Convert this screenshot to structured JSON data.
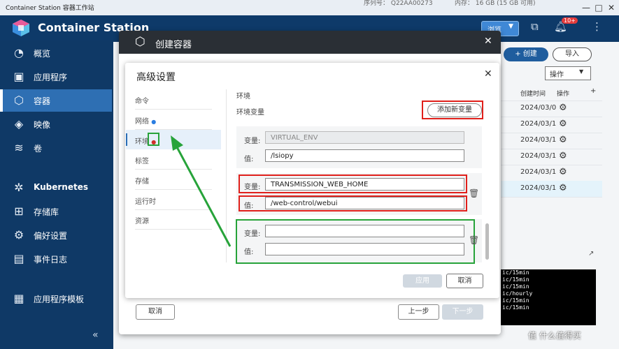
{
  "window": {
    "title": "Container Station 容器工作站",
    "serial_fragment": "序列号： Q22AA00273",
    "memory_fragment": "内存： 16 GB (15 GB 可用)",
    "controls": [
      "minimize-icon",
      "maximize-icon",
      "close-icon"
    ]
  },
  "header": {
    "app_name": "Container Station",
    "browse_label": "浏览",
    "notification_badge": "10+"
  },
  "sidebar": {
    "items": [
      {
        "label": "概览",
        "icon": "overview-icon"
      },
      {
        "label": "应用程序",
        "icon": "applications-icon"
      },
      {
        "label": "容器",
        "icon": "container-icon",
        "active": true
      },
      {
        "label": "映像",
        "icon": "images-icon"
      },
      {
        "label": "卷",
        "icon": "volume-icon"
      },
      {
        "label": "Kubernetes",
        "icon": "kubernetes-icon"
      },
      {
        "label": "存储库",
        "icon": "registry-icon"
      },
      {
        "label": "偏好设置",
        "icon": "gear-icon"
      },
      {
        "label": "事件日志",
        "icon": "log-icon"
      },
      {
        "label": "应用程序模板",
        "icon": "template-icon"
      }
    ]
  },
  "background": {
    "create_label": "+ 创建",
    "import_label": "导入",
    "actions_select": "操作",
    "columns": [
      "创建时间",
      "操作"
    ],
    "dates": [
      "2024/03/0",
      "2024/03/1",
      "2024/03/1",
      "2024/03/1",
      "2024/03/1",
      "2024/03/1"
    ],
    "log_lines": [
      "ic/15min",
      "ic/15min",
      "ic/15min",
      "ic/hourly",
      "ic/15min",
      "ic/15min"
    ]
  },
  "create_dialog": {
    "title": "创建容器",
    "cancel_label": "取消",
    "prev_label": "上一步",
    "next_label": "下一步"
  },
  "advanced": {
    "title": "高级设置",
    "nav": [
      {
        "label": "命令"
      },
      {
        "label": "网络",
        "dot": "blue"
      },
      {
        "label": "环境",
        "dot": "red",
        "active": true
      },
      {
        "label": "标签"
      },
      {
        "label": "存储"
      },
      {
        "label": "运行时"
      },
      {
        "label": "资源"
      }
    ],
    "section_title": "环境",
    "env_title": "环境变量",
    "add_var_label": "添加新变量",
    "var_label": "变量:",
    "value_label": "值:",
    "env_rows": [
      {
        "var": "VIRTUAL_ENV",
        "value": "/lsiopy",
        "locked": true
      },
      {
        "var": "TRANSMISSION_WEB_HOME",
        "value": "/web-control/webui",
        "locked": false
      },
      {
        "var": "",
        "value": "",
        "locked": false
      }
    ],
    "apply_label": "应用",
    "cancel_label": "取消"
  },
  "watermark": "值 什么值得买",
  "colors": {
    "header": "#0e3a69",
    "active": "#2e6fb3",
    "highlight_red": "#e0201b",
    "highlight_green": "#27a33a"
  }
}
